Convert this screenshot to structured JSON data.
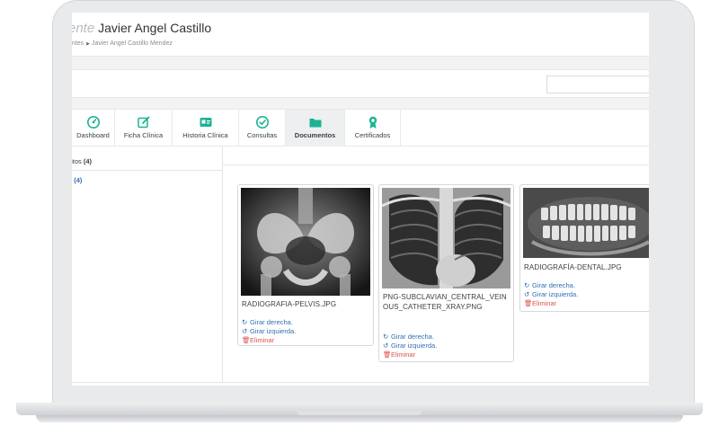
{
  "header": {
    "title_faded": "ente",
    "title_name": "Javier Angel Castillo",
    "breadcrumb_parent": "entes",
    "breadcrumb_current": "Javier Angel Castillo Mendez"
  },
  "tabs": [
    {
      "label": "Dashboard",
      "icon": "dashboard-icon"
    },
    {
      "label": "Ficha Clínica",
      "icon": "edit-icon"
    },
    {
      "label": "Historia Clínica",
      "icon": "id-card-icon"
    },
    {
      "label": "Consultas",
      "icon": "clock-check-icon"
    },
    {
      "label": "Documentos",
      "icon": "folder-icon"
    },
    {
      "label": "Certificados",
      "icon": "award-icon"
    }
  ],
  "sidebar": {
    "heading": "umentos",
    "heading_count": "(4)",
    "item": "s",
    "item_count": "(4)"
  },
  "documents": [
    {
      "filename": "RADIOGRAFIA-PELVIS.JPG"
    },
    {
      "filename": "PNG-SUBCLAVIAN_CENTRAL_VEINOUS_CATHETER_XRAY.PNG"
    },
    {
      "filename": "RADIOGRAFÍA-DENTAL.JPG"
    }
  ],
  "actions": {
    "rotate_right": "Girar derecha.",
    "rotate_left": "Girar izquierda.",
    "delete": "Eliminar"
  },
  "colors": {
    "accent_green": "#1ab394",
    "link_blue": "#2f6fb3",
    "danger_red": "#d9534f"
  }
}
